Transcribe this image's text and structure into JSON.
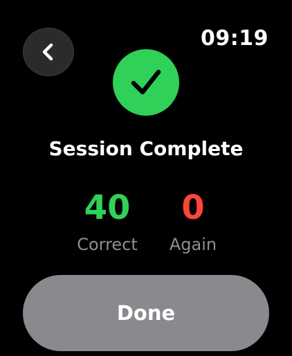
{
  "status_bar": {
    "time": "09:19"
  },
  "nav": {
    "back_icon": "chevron-left-icon"
  },
  "badge": {
    "icon": "checkmark-icon",
    "color": "#30d158"
  },
  "summary": {
    "title": "Session Complete",
    "correct": {
      "value": "40",
      "label": "Correct",
      "color": "#30d158"
    },
    "again": {
      "value": "0",
      "label": "Again",
      "color": "#ff453a"
    }
  },
  "actions": {
    "done_label": "Done"
  }
}
